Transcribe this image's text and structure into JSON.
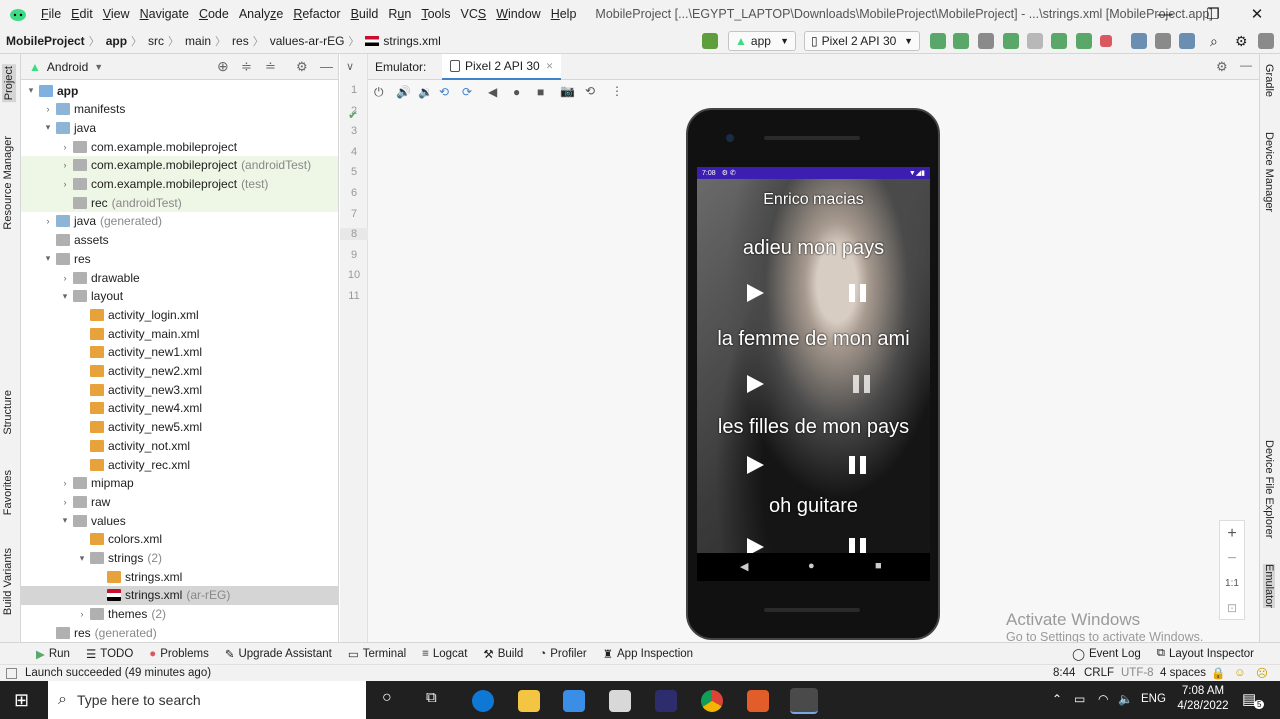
{
  "menu": {
    "items": [
      "File",
      "Edit",
      "View",
      "Navigate",
      "Code",
      "Analyze",
      "Refactor",
      "Build",
      "Run",
      "Tools",
      "VCS",
      "Window",
      "Help"
    ],
    "underline": [
      "F",
      "E",
      "V",
      "N",
      "C",
      "z",
      "R",
      "B",
      "u",
      "T",
      "S",
      "W",
      "H"
    ],
    "title": "MobileProject [...\\EGYPT_LAPTOP\\Downloads\\MobileProject\\MobileProject] - ...\\strings.xml [MobileProject.app]",
    "win": [
      "—",
      "❐",
      "✕"
    ]
  },
  "nav": {
    "crumbs": [
      "MobileProject",
      "app",
      "src",
      "main",
      "res",
      "values-ar-rEG",
      "strings.xml"
    ],
    "run_config": "app",
    "device": "Pixel 2 API 30"
  },
  "left_strip": [
    "Project",
    "Resource Manager",
    "Structure",
    "Favorites",
    "Build Variants"
  ],
  "right_strip": [
    "Gradle",
    "Device Manager",
    "Device File Explorer",
    "Emulator"
  ],
  "project": {
    "view": "Android",
    "tree": [
      {
        "label": "app",
        "sub": "",
        "depth": 0,
        "arrow": "▾",
        "icon": "app",
        "bold": true,
        "hl": false
      },
      {
        "label": "manifests",
        "sub": "",
        "depth": 1,
        "arrow": "›",
        "icon": "fold",
        "bold": false,
        "hl": false
      },
      {
        "label": "java",
        "sub": "",
        "depth": 1,
        "arrow": "▾",
        "icon": "fold",
        "bold": false,
        "hl": false
      },
      {
        "label": "com.example.mobileproject",
        "sub": "",
        "depth": 2,
        "arrow": "›",
        "icon": "foldg",
        "bold": false,
        "hl": false
      },
      {
        "label": "com.example.mobileproject",
        "sub": "(androidTest)",
        "depth": 2,
        "arrow": "›",
        "icon": "foldg",
        "bold": false,
        "hl": true
      },
      {
        "label": "com.example.mobileproject",
        "sub": "(test)",
        "depth": 2,
        "arrow": "›",
        "icon": "foldg",
        "bold": false,
        "hl": true
      },
      {
        "label": "rec",
        "sub": "(androidTest)",
        "depth": 2,
        "arrow": "",
        "icon": "foldg",
        "bold": false,
        "hl": true
      },
      {
        "label": "java",
        "sub": "(generated)",
        "depth": 1,
        "arrow": "›",
        "icon": "fold",
        "bold": false,
        "hl": false
      },
      {
        "label": "assets",
        "sub": "",
        "depth": 1,
        "arrow": "",
        "icon": "foldg",
        "bold": false,
        "hl": false
      },
      {
        "label": "res",
        "sub": "",
        "depth": 1,
        "arrow": "▾",
        "icon": "foldg",
        "bold": false,
        "hl": false
      },
      {
        "label": "drawable",
        "sub": "",
        "depth": 2,
        "arrow": "›",
        "icon": "foldg",
        "bold": false,
        "hl": false
      },
      {
        "label": "layout",
        "sub": "",
        "depth": 2,
        "arrow": "▾",
        "icon": "foldg",
        "bold": false,
        "hl": false
      },
      {
        "label": "activity_login.xml",
        "sub": "",
        "depth": 3,
        "arrow": "",
        "icon": "xml",
        "bold": false,
        "hl": false
      },
      {
        "label": "activity_main.xml",
        "sub": "",
        "depth": 3,
        "arrow": "",
        "icon": "xml",
        "bold": false,
        "hl": false
      },
      {
        "label": "activity_new1.xml",
        "sub": "",
        "depth": 3,
        "arrow": "",
        "icon": "xml",
        "bold": false,
        "hl": false
      },
      {
        "label": "activity_new2.xml",
        "sub": "",
        "depth": 3,
        "arrow": "",
        "icon": "xml",
        "bold": false,
        "hl": false
      },
      {
        "label": "activity_new3.xml",
        "sub": "",
        "depth": 3,
        "arrow": "",
        "icon": "xml",
        "bold": false,
        "hl": false
      },
      {
        "label": "activity_new4.xml",
        "sub": "",
        "depth": 3,
        "arrow": "",
        "icon": "xml",
        "bold": false,
        "hl": false
      },
      {
        "label": "activity_new5.xml",
        "sub": "",
        "depth": 3,
        "arrow": "",
        "icon": "xml",
        "bold": false,
        "hl": false
      },
      {
        "label": "activity_not.xml",
        "sub": "",
        "depth": 3,
        "arrow": "",
        "icon": "xml",
        "bold": false,
        "hl": false
      },
      {
        "label": "activity_rec.xml",
        "sub": "",
        "depth": 3,
        "arrow": "",
        "icon": "xml",
        "bold": false,
        "hl": false
      },
      {
        "label": "mipmap",
        "sub": "",
        "depth": 2,
        "arrow": "›",
        "icon": "foldg",
        "bold": false,
        "hl": false
      },
      {
        "label": "raw",
        "sub": "",
        "depth": 2,
        "arrow": "›",
        "icon": "foldg",
        "bold": false,
        "hl": false
      },
      {
        "label": "values",
        "sub": "",
        "depth": 2,
        "arrow": "▾",
        "icon": "foldg",
        "bold": false,
        "hl": false
      },
      {
        "label": "colors.xml",
        "sub": "",
        "depth": 3,
        "arrow": "",
        "icon": "xml",
        "bold": false,
        "hl": false
      },
      {
        "label": "strings",
        "sub": "(2)",
        "depth": 3,
        "arrow": "▾",
        "icon": "foldg",
        "bold": false,
        "hl": false
      },
      {
        "label": "strings.xml",
        "sub": "",
        "depth": 4,
        "arrow": "",
        "icon": "xml",
        "bold": false,
        "hl": false
      },
      {
        "label": "strings.xml",
        "sub": "(ar-rEG)",
        "depth": 4,
        "arrow": "",
        "icon": "flag",
        "bold": false,
        "hl": false,
        "selected": true
      },
      {
        "label": "themes",
        "sub": "(2)",
        "depth": 3,
        "arrow": "›",
        "icon": "foldg",
        "bold": false,
        "hl": false
      },
      {
        "label": "res",
        "sub": "(generated)",
        "depth": 1,
        "arrow": "",
        "icon": "foldg",
        "bold": false,
        "hl": false
      }
    ]
  },
  "editor": {
    "line_numbers": [
      "1",
      "2",
      "3",
      "4",
      "5",
      "6",
      "7",
      "8",
      "9",
      "10",
      "11"
    ]
  },
  "emulator": {
    "label": "Emulator:",
    "tab": "Pixel 2 API 30",
    "tab_close": "✕"
  },
  "phone": {
    "time": "7:08",
    "status_icons": "⚙ ✆",
    "artist": "Enrico macias",
    "songs": [
      "adieu mon pays",
      "la femme de mon ami",
      "les filles de mon pays",
      "oh guitare"
    ]
  },
  "zoom": {
    "plus": "+",
    "minus": "−",
    "ratio": "1:1"
  },
  "watermark": {
    "line1": "Activate Windows",
    "line2": "Go to Settings to activate Windows."
  },
  "bottom_tabs": [
    "Run",
    "TODO",
    "Problems",
    "Upgrade Assistant",
    "Terminal",
    "Logcat",
    "Build",
    "Profiler",
    "App Inspection"
  ],
  "bottom_right": [
    "Event Log",
    "Layout Inspector"
  ],
  "status": {
    "message": "Launch succeeded (49 minutes ago)",
    "position": "8:44",
    "line_sep": "CRLF",
    "encoding": "UTF-8",
    "indent": "4 spaces"
  },
  "taskbar": {
    "search_placeholder": "Type here to search",
    "lang": "ENG",
    "time": "7:08 AM",
    "date": "4/28/2022",
    "notif_count": "5"
  }
}
